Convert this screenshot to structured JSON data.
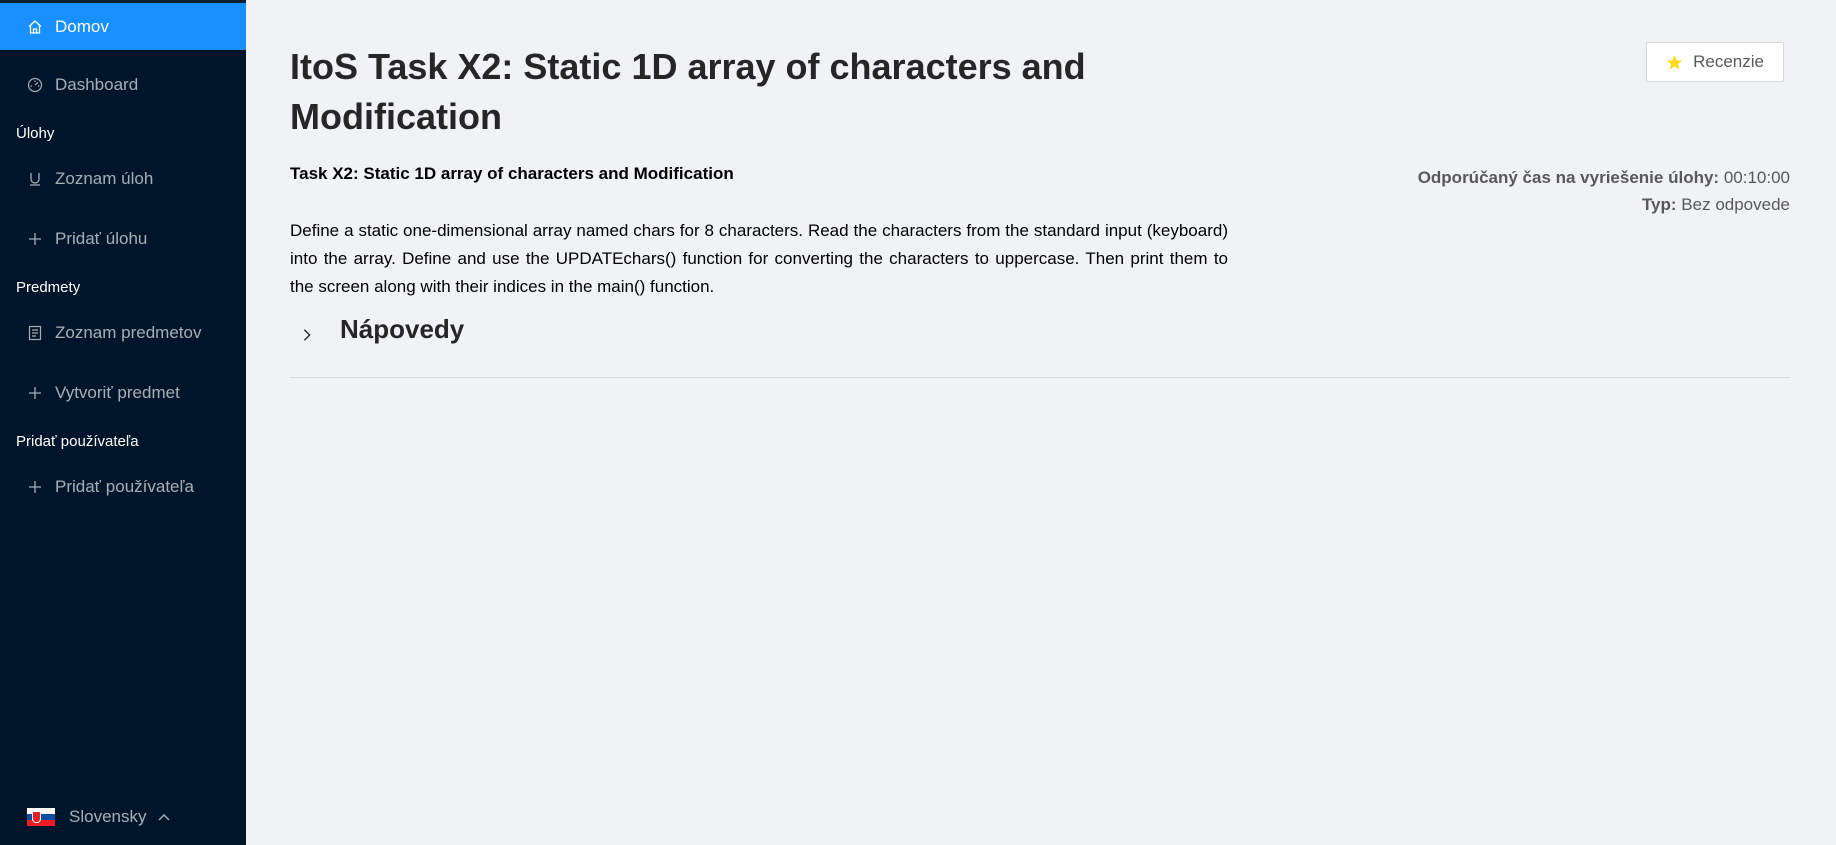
{
  "sidebar": {
    "items": [
      {
        "label": "Domov",
        "icon": "home-icon"
      },
      {
        "label": "Dashboard",
        "icon": "dashboard-icon"
      }
    ],
    "groups": [
      {
        "title": "Úlohy",
        "items": [
          {
            "label": "Zoznam úloh",
            "icon": "list-icon"
          },
          {
            "label": "Pridať úlohu",
            "icon": "plus-icon"
          }
        ]
      },
      {
        "title": "Predmety",
        "items": [
          {
            "label": "Zoznam predmetov",
            "icon": "book-icon"
          },
          {
            "label": "Vytvoriť predmet",
            "icon": "plus-icon"
          }
        ]
      },
      {
        "title": "Pridať používateľa",
        "items": [
          {
            "label": "Pridať používateľa",
            "icon": "plus-icon"
          }
        ]
      }
    ],
    "language": "Slovensky",
    "active_color": "#1890ff",
    "bg_color": "#001529"
  },
  "main": {
    "title": "ItoS Task X2: Static 1D array of characters and Modification",
    "reviews_button": "Recenzie",
    "subtitle": "Task X2: Static 1D array of characters and Modification",
    "meta": {
      "time_label": "Odporúčaný čas na vyriešenie úlohy:",
      "time_value": "00:10:00",
      "type_label": "Typ:",
      "type_value": "Bez odpovede"
    },
    "description": "Define a static one-dimensional array named chars for 8 characters. Read the characters from the standard input (keyboard) into the array. Define and use the UPDATEchars() function for converting the characters to uppercase. Then print them to the screen along with their indices in the main() function.",
    "hints_label": "Nápovedy"
  }
}
